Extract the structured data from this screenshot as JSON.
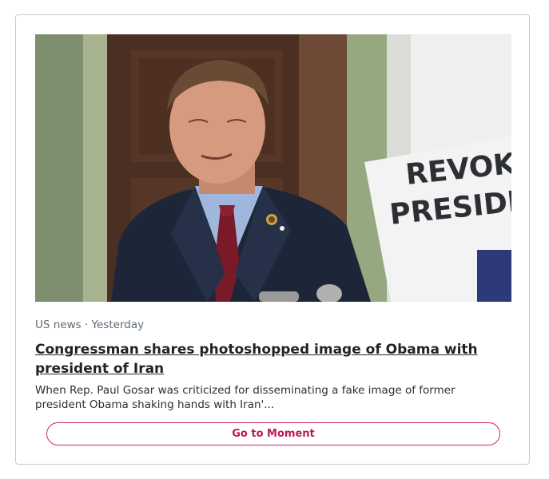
{
  "card": {
    "image_alt_icon": "news-photo",
    "meta": "US news · Yesterday",
    "headline": "Congressman shares photoshopped image of Obama with president of Iran",
    "summary": "When Rep. Paul Gosar was criticized for disseminating a fake image of former president Obama shaking hands with Iran'...",
    "cta_label": "Go to Moment",
    "sign_line1": "REVOK",
    "sign_line2": "PRESIDE"
  },
  "colors": {
    "accent": "#d0276b",
    "border": "#c7c9cc",
    "meta_text": "#5f6b76"
  }
}
